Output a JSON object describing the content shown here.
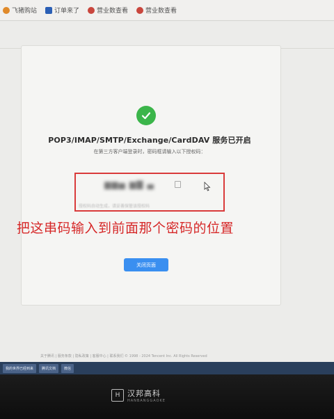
{
  "bookmarks": [
    {
      "label": "飞猪购站",
      "icon": "orange-circle-icon"
    },
    {
      "label": "订单来了",
      "icon": "blue-square-icon"
    },
    {
      "label": "营业数查看",
      "icon": "red-circle-icon"
    },
    {
      "label": "营业数查看",
      "icon": "red-circle-icon"
    }
  ],
  "dialog": {
    "title": "POP3/IMAP/SMTP/Exchange/CardDAV 服务已开启",
    "subtitle": "在第三方客户端登录时，密码框请输入以下授权码：",
    "auth_code": "▆▆▅ ▆▇ ▄",
    "hint": "授权码自动生成，请妥善保管该授权码",
    "close_button": "关闭页面"
  },
  "annotation": "把这串码输入到前面那个密码的位置",
  "footer": "关于腾讯 | 服务条款 | 隐私政策 | 客服中心 | 联系我们  © 1998 - 2024 Tencent Inc. All Rights Reserved",
  "taskbar": {
    "items": [
      "我的世界已经到来",
      "腾讯文档",
      "微信"
    ]
  },
  "monitor": {
    "brand_name": "汉邦高科",
    "brand_sub": "HANBANGGAOKE",
    "brand_mark": "H"
  },
  "colors": {
    "success": "#3bb54a",
    "annotation_red": "#d62828",
    "button_blue": "#3a8ff0"
  }
}
